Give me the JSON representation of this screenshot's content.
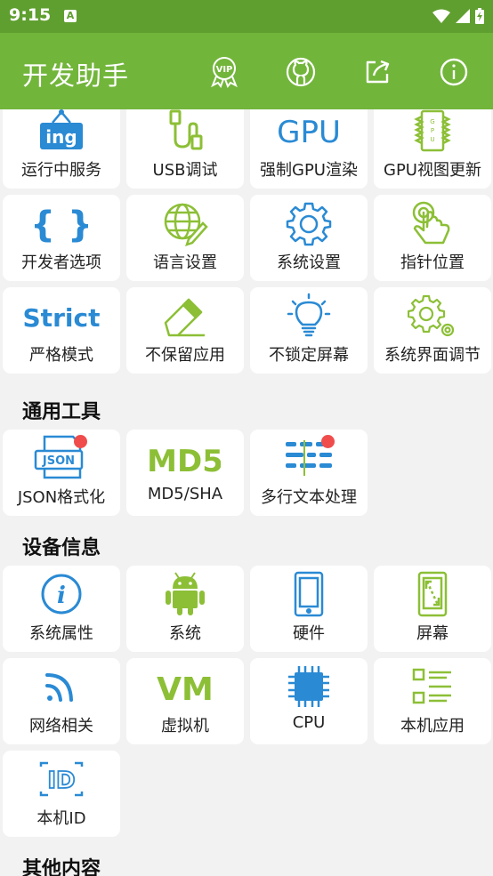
{
  "status": {
    "time": "9:15",
    "notif_letter": "A"
  },
  "app": {
    "title": "开发助手"
  },
  "top_items": [
    {
      "label": "运行中服务",
      "icon": "ing-icon",
      "icon_text": "ing"
    },
    {
      "label": "USB调试",
      "icon": "usb-cable-icon"
    },
    {
      "label": "强制GPU渲染",
      "icon": "gpu-text-icon",
      "icon_text": "GPU"
    },
    {
      "label": "GPU视图更新",
      "icon": "gpu-chip-icon"
    },
    {
      "label": "开发者选项",
      "icon": "braces-icon",
      "icon_text": "{ }"
    },
    {
      "label": "语言设置",
      "icon": "globe-pencil-icon"
    },
    {
      "label": "系统设置",
      "icon": "gear-icon"
    },
    {
      "label": "指针位置",
      "icon": "touch-hand-icon"
    },
    {
      "label": "严格模式",
      "icon": "strict-text-icon",
      "icon_text": "Strict"
    },
    {
      "label": "不保留应用",
      "icon": "eraser-icon"
    },
    {
      "label": "不锁定屏幕",
      "icon": "lightbulb-icon"
    },
    {
      "label": "系统界面调节",
      "icon": "gears-icon"
    }
  ],
  "sections": {
    "tools": "通用工具",
    "device": "设备信息",
    "other": "其他内容"
  },
  "tools_items": [
    {
      "label": "JSON格式化",
      "icon": "json-file-icon",
      "icon_text": "JSON",
      "badge": true
    },
    {
      "label": "MD5/SHA",
      "icon": "md5-text-icon",
      "icon_text": "MD5"
    },
    {
      "label": "多行文本处理",
      "icon": "multiline-text-icon",
      "badge": true
    }
  ],
  "device_items": [
    {
      "label": "系统属性",
      "icon": "info-circle-icon"
    },
    {
      "label": "系统",
      "icon": "android-icon"
    },
    {
      "label": "硬件",
      "icon": "phone-icon"
    },
    {
      "label": "屏幕",
      "icon": "screen-icon"
    },
    {
      "label": "网络相关",
      "icon": "wifi-signal-icon"
    },
    {
      "label": "虚拟机",
      "icon": "vm-text-icon",
      "icon_text": "VM"
    },
    {
      "label": "CPU",
      "icon": "cpu-chip-icon"
    },
    {
      "label": "本机应用",
      "icon": "app-list-icon"
    },
    {
      "label": "本机ID",
      "icon": "id-card-icon",
      "icon_text": "ID"
    }
  ],
  "colors": {
    "appbar": "#72b53b",
    "statusbar": "#5f9f2f",
    "blue": "#2a8ad4",
    "green": "#8cbf36",
    "badge": "#f04c4c"
  }
}
